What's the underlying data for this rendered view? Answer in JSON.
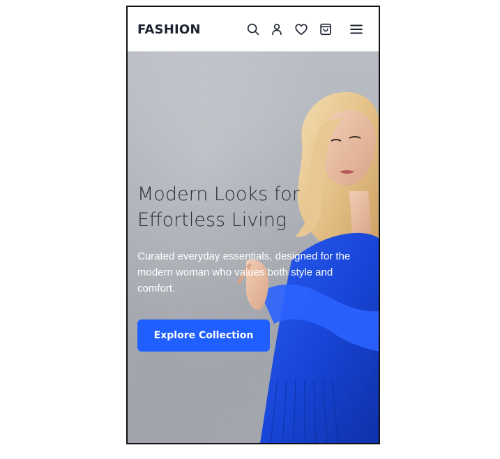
{
  "header": {
    "logo": "FASHION",
    "icons": [
      "search-icon",
      "user-icon",
      "heart-icon",
      "cart-icon",
      "menu-icon"
    ]
  },
  "hero": {
    "title_line1": "Modern Looks for",
    "title_line2": "Effortless Living",
    "subtitle": "Curated everyday essentials, designed for the modern woman who values both style and comfort.",
    "cta_label": "Explore Collection"
  },
  "colors": {
    "accent": "#1f5fff",
    "dress": "#1846d8",
    "text_dark": "#1d2230"
  }
}
